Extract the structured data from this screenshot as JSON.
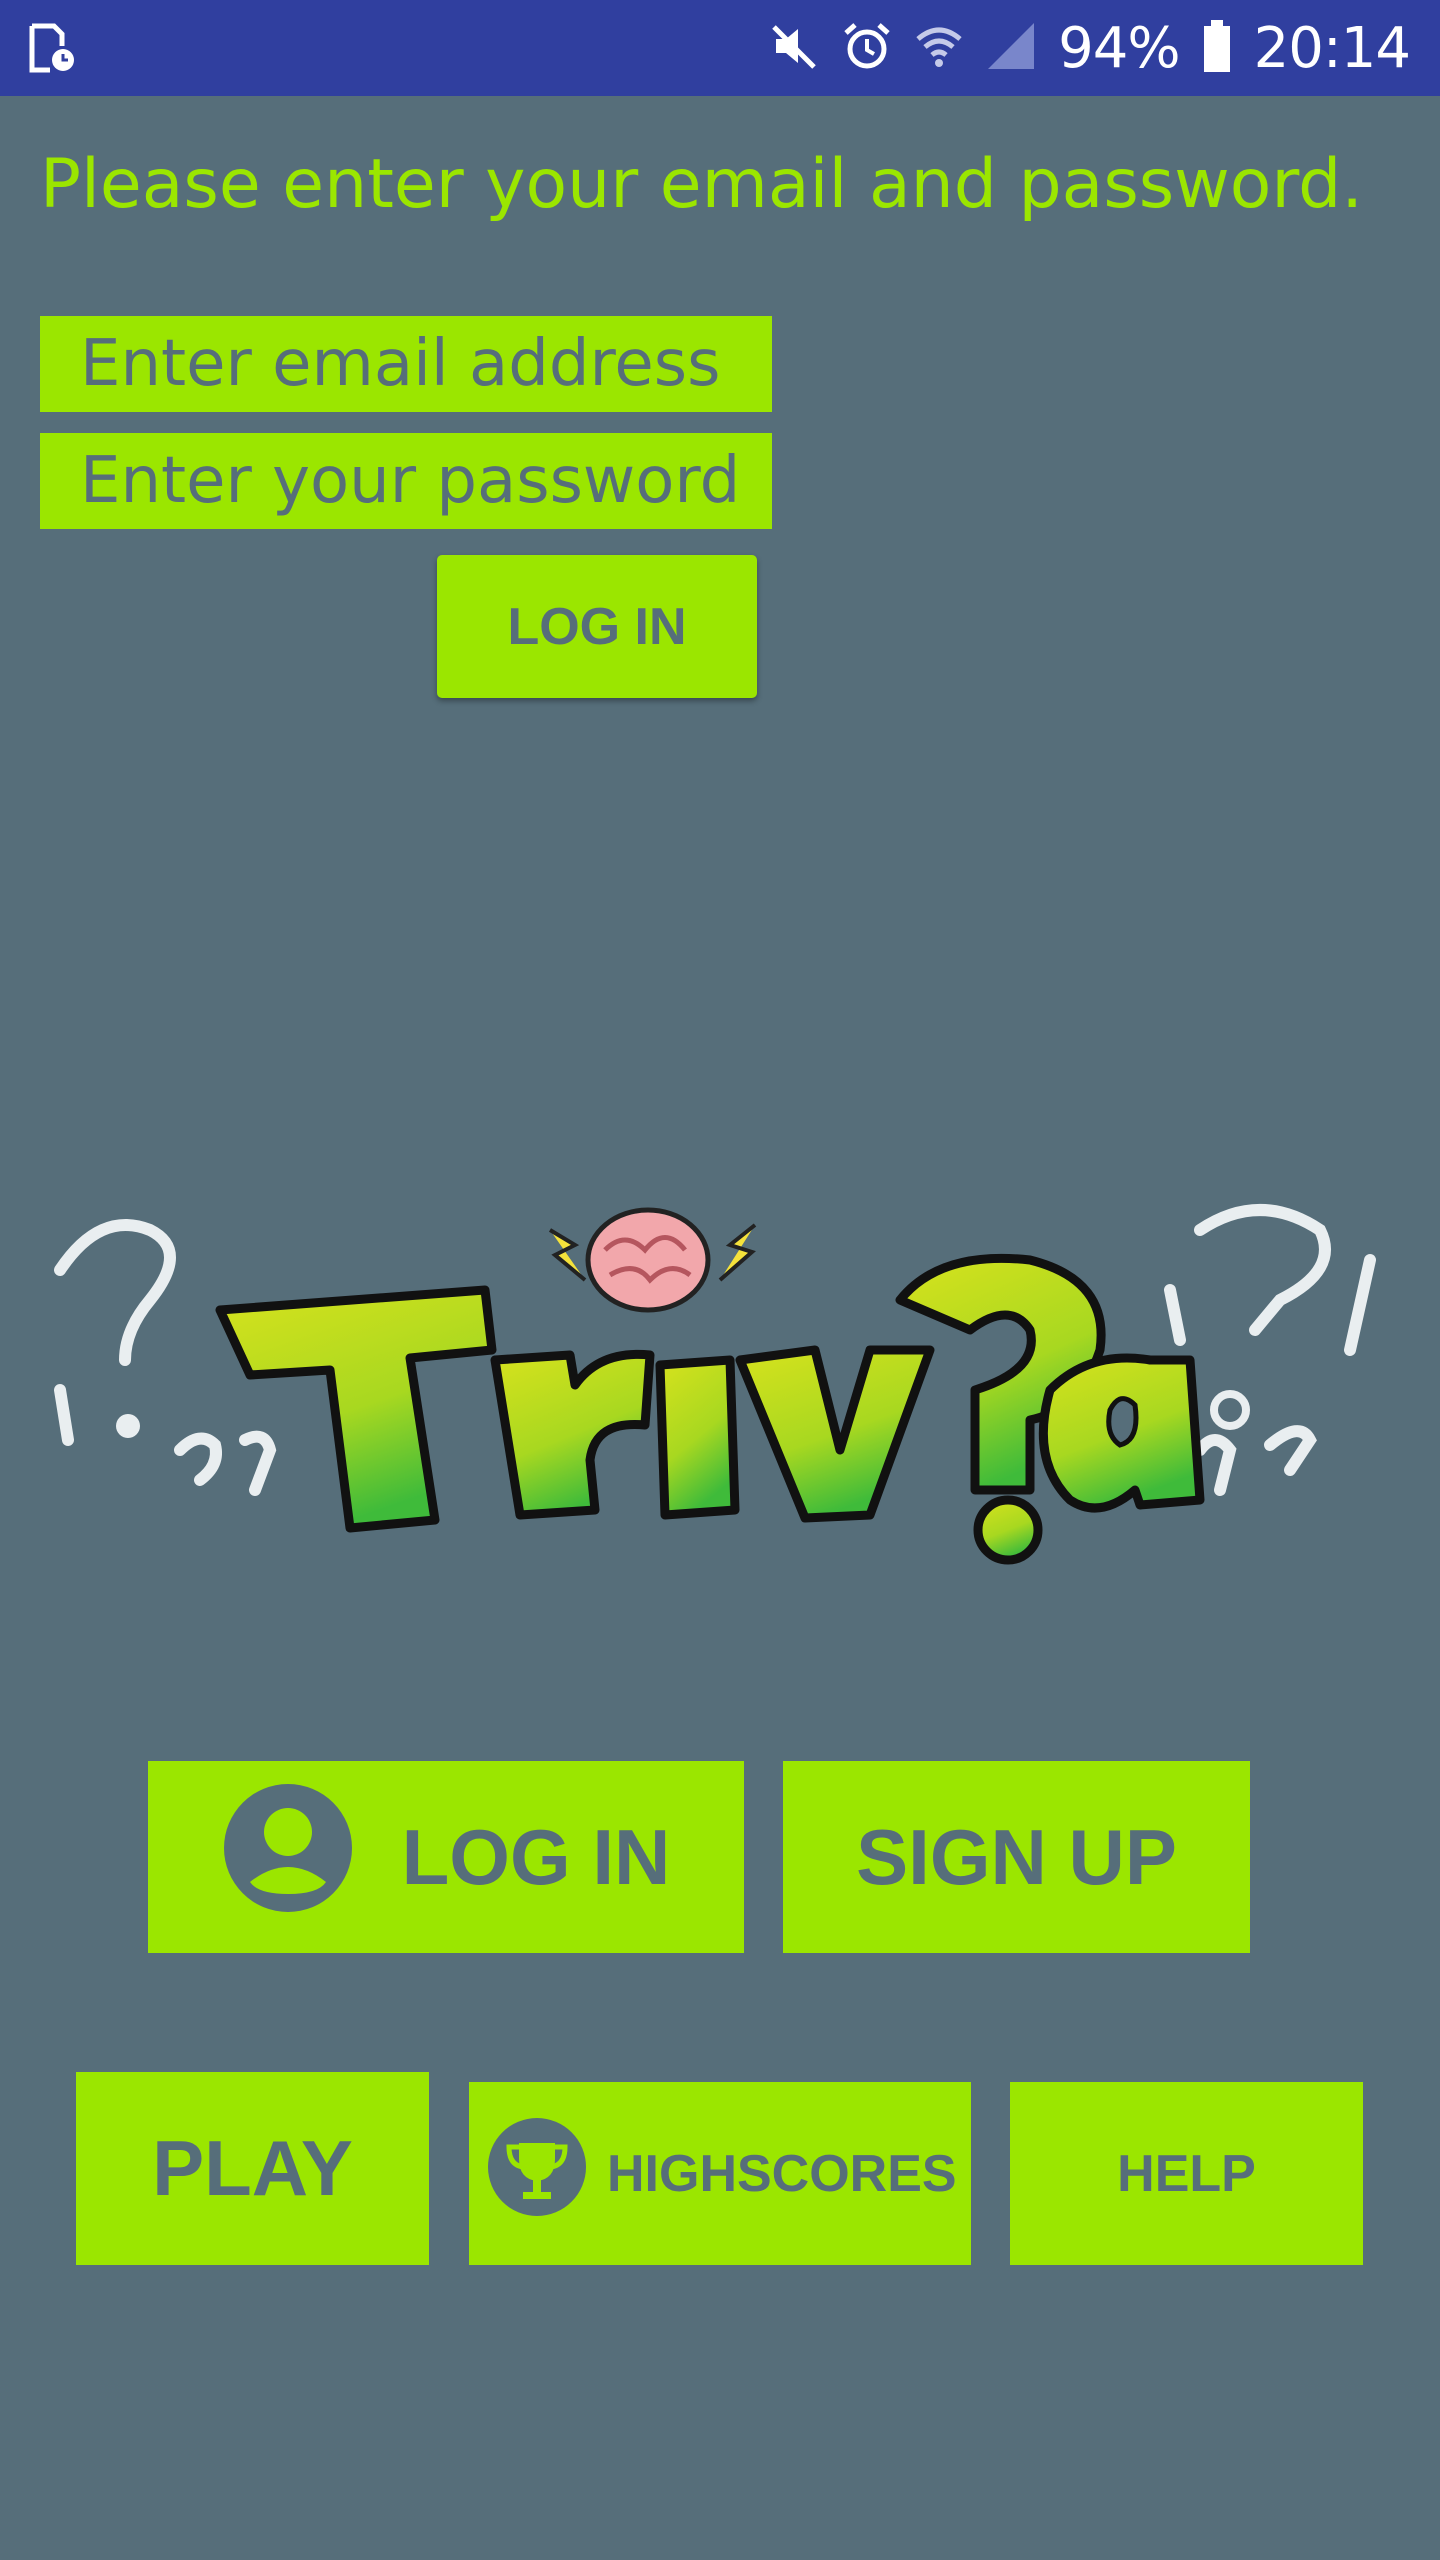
{
  "status_bar": {
    "battery": "94%",
    "time": "20:14",
    "icons": [
      "screenshot-icon",
      "mute-icon",
      "alarm-icon",
      "wifi-icon",
      "signal-icon",
      "battery-icon"
    ]
  },
  "login_form": {
    "prompt": "Please enter your email and password.",
    "email_placeholder": "Enter email address",
    "password_placeholder": "Enter your password",
    "login_label": "LOG IN"
  },
  "logo": {
    "alt_text": "Triv?a"
  },
  "menu": {
    "login_label": "LOG IN",
    "signup_label": "SIGN UP",
    "play_label": "PLAY",
    "highscores_label": "HIGHSCORES",
    "help_label": "HELP"
  },
  "colors": {
    "background": "#566e7a",
    "status_bar": "#303f9f",
    "accent": "#9be600"
  }
}
